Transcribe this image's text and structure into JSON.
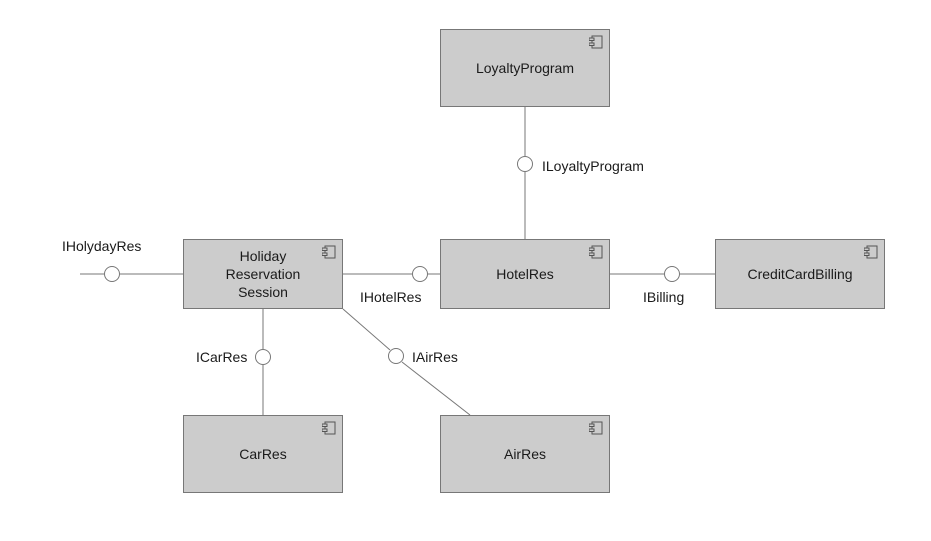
{
  "components": {
    "loyaltyProgram": "LoyaltyProgram",
    "holidayReservationSession": "Holiday\nReservation\nSession",
    "hotelRes": "HotelRes",
    "creditCardBilling": "CreditCardBilling",
    "carRes": "CarRes",
    "airRes": "AirRes"
  },
  "interfaces": {
    "iHolydayRes": "IHolydayRes",
    "iLoyaltyProgram": "ILoyaltyProgram",
    "iHotelRes": "IHotelRes",
    "iBilling": "IBilling",
    "iCarRes": "ICarRes",
    "iAirRes": "IAirRes"
  }
}
